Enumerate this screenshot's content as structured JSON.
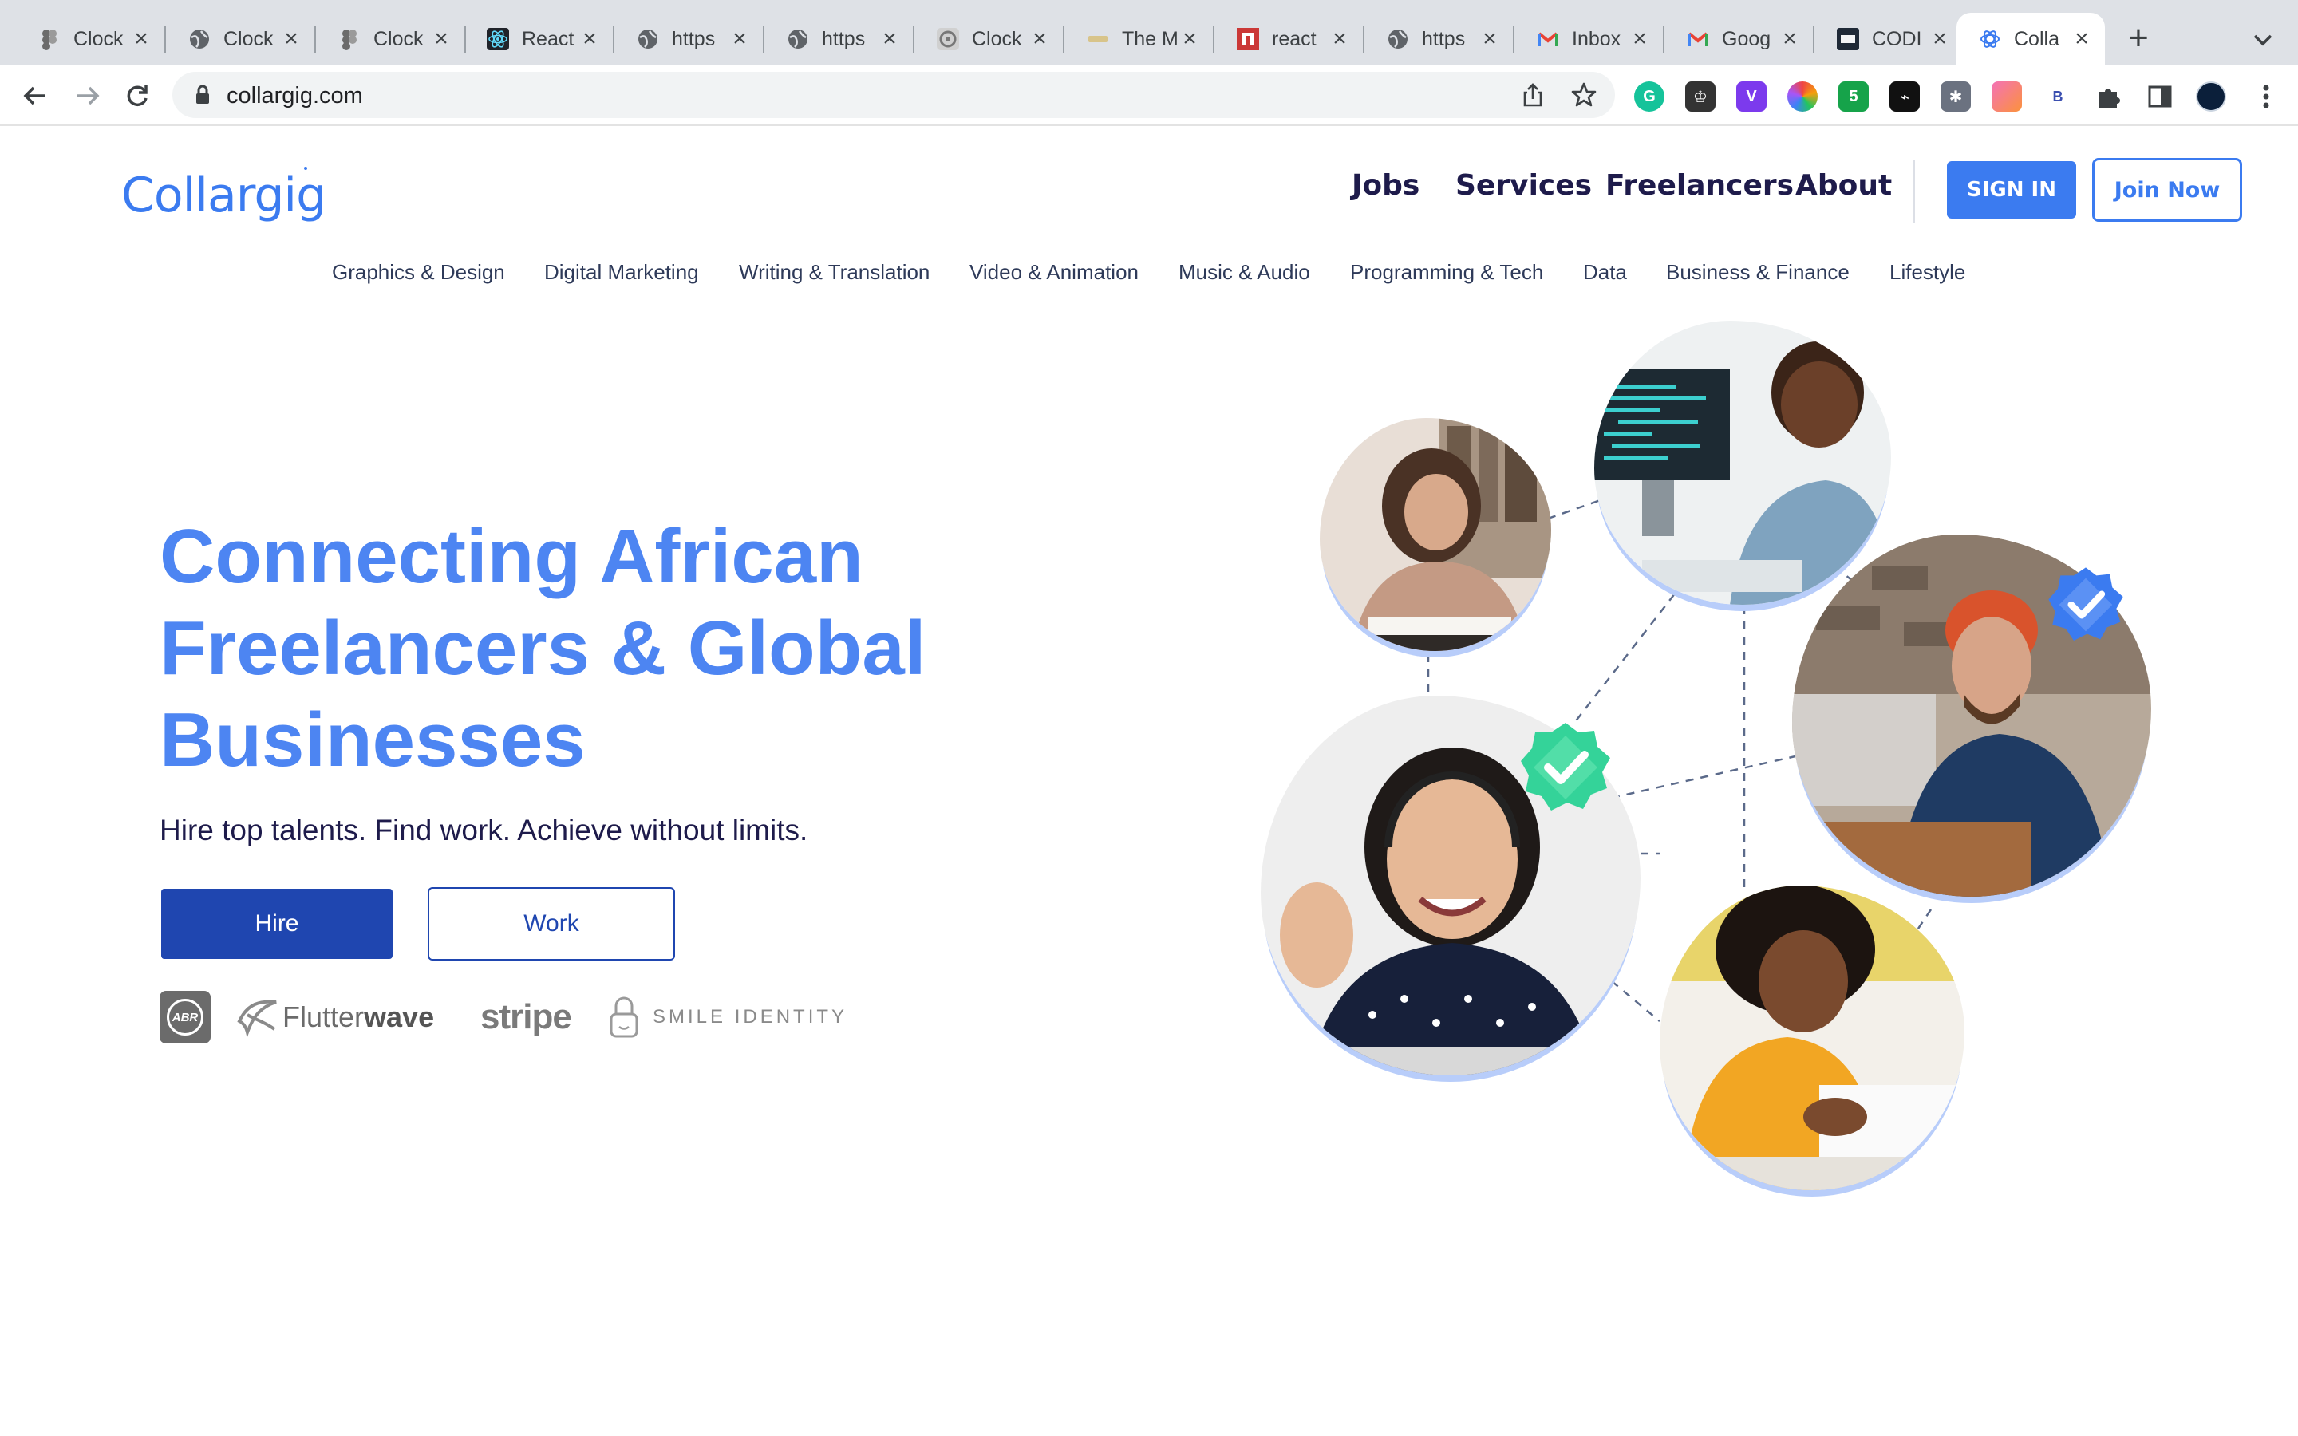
{
  "browser": {
    "tabs": [
      {
        "title": "Clock",
        "favicon": "figma-icon",
        "color": "#6b6b6b"
      },
      {
        "title": "Clock",
        "favicon": "globe-icon",
        "color": "#5f6368"
      },
      {
        "title": "Clock",
        "favicon": "figma-icon",
        "color": "#6b6b6b"
      },
      {
        "title": "React",
        "favicon": "react-icon",
        "color": "#61dafb"
      },
      {
        "title": "https",
        "favicon": "globe-icon",
        "color": "#5f6368"
      },
      {
        "title": "https",
        "favicon": "globe-icon",
        "color": "#5f6368"
      },
      {
        "title": "Clock",
        "favicon": "clockify-icon",
        "color": "#777777"
      },
      {
        "title": "The M",
        "favicon": "the-m-icon",
        "color": "#d8c48a"
      },
      {
        "title": "react",
        "favicon": "npm-icon",
        "color": "#cb3837"
      },
      {
        "title": "https",
        "favicon": "globe-icon",
        "color": "#5f6368"
      },
      {
        "title": "Inbox",
        "favicon": "gmail-icon",
        "color": "#ea4335"
      },
      {
        "title": "Goog",
        "favicon": "gmail-icon",
        "color": "#ea4335"
      },
      {
        "title": "CODI",
        "favicon": "codi-icon",
        "color": "#1f2937"
      },
      {
        "title": "Colla",
        "favicon": "collargig-icon",
        "color": "#3b7bf0",
        "active": true
      }
    ],
    "url": "collargig.com",
    "extensions": [
      {
        "name": "grammarly-icon",
        "color": "#15c39a",
        "label": "G"
      },
      {
        "name": "crown-extension-icon",
        "color": "#333333",
        "label": "♔"
      },
      {
        "name": "v-extension-icon",
        "color": "#7c3aed",
        "label": "V"
      },
      {
        "name": "color-wheel-icon",
        "color": "#e11d48",
        "label": ""
      },
      {
        "name": "vivid-extension-icon",
        "color": "#16a34a",
        "label": "5"
      },
      {
        "name": "fire-extension-icon",
        "color": "#111111",
        "label": "⌁"
      },
      {
        "name": "bug-extension-icon",
        "color": "#6b7280",
        "label": "✱"
      },
      {
        "name": "gradient-extension-icon",
        "color": "#ec4899",
        "label": ""
      },
      {
        "name": "b-extension-icon",
        "color": "#ffffff",
        "label": "B"
      },
      {
        "name": "puzzle-icon",
        "color": "#ffffff",
        "label": ""
      },
      {
        "name": "sidepanel-icon",
        "color": "#ffffff",
        "label": ""
      },
      {
        "name": "profile-avatar-icon",
        "color": "#0b1f3a",
        "label": ""
      }
    ]
  },
  "site": {
    "logo": "Collargig",
    "nav": [
      "Jobs",
      "Services",
      "Freelancers",
      "About"
    ],
    "sign_in": "SIGN IN",
    "join_now": "Join Now",
    "categories": [
      "Graphics & Design",
      "Digital Marketing",
      "Writing & Translation",
      "Video & Animation",
      "Music & Audio",
      "Programming & Tech",
      "Data",
      "Business & Finance",
      "Lifestyle"
    ],
    "hero": {
      "title_line1": "Connecting African",
      "title_line2": "Freelancers & Global",
      "title_line3": "Businesses",
      "subtitle": "Hire top talents. Find work. Achieve without limits.",
      "hire": "Hire",
      "work": "Work"
    },
    "partners": {
      "abr": "ABR",
      "flutterwave_a": "Flutter",
      "flutterwave_b": "wave",
      "stripe": "stripe",
      "smile": "SMILE IDENTITY"
    },
    "colors": {
      "brand_blue": "#3b7bf0",
      "hero_blue": "#4d85f2",
      "dark_navy": "#1e1b4b",
      "button_blue": "#1f46b0",
      "verified_green": "#34d399"
    }
  }
}
